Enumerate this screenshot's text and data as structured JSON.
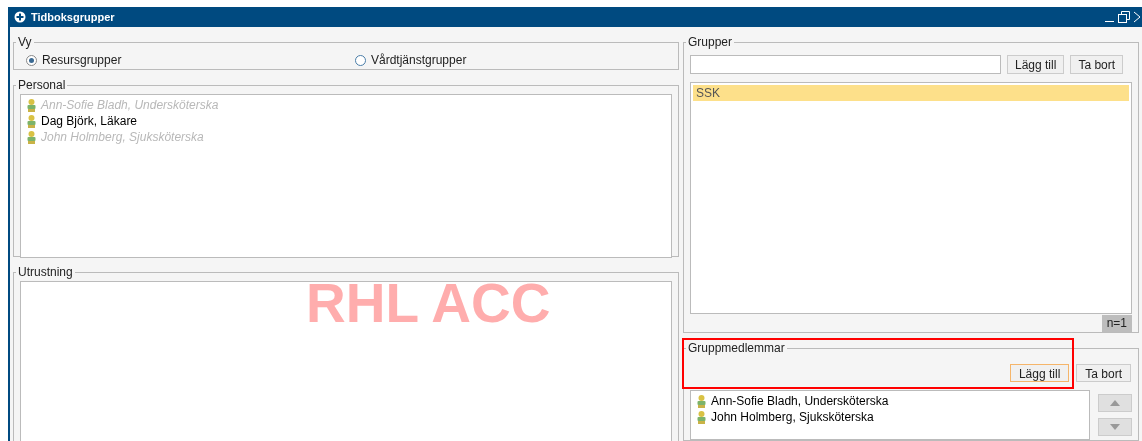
{
  "window": {
    "title": "Tidboksgrupper",
    "environment_label": "RHL ACC"
  },
  "vy": {
    "title": "Vy",
    "options": [
      {
        "label": "Resursgrupper",
        "selected": true
      },
      {
        "label": "Vårdtjänstgrupper",
        "selected": false
      }
    ]
  },
  "personal": {
    "title": "Personal",
    "items": [
      {
        "label": "Ann-Sofie Bladh, Undersköterska",
        "inactive": true
      },
      {
        "label": "Dag Björk, Läkare",
        "inactive": false
      },
      {
        "label": "John Holmberg, Sjuksköterska",
        "inactive": true
      }
    ]
  },
  "utrustning": {
    "title": "Utrustning"
  },
  "grupper": {
    "title": "Grupper",
    "add_button": "Lägg till",
    "remove_button": "Ta bort",
    "items": [
      {
        "label": "SSK",
        "selected": true
      }
    ],
    "count": "n=1"
  },
  "gruppmedlemmar": {
    "title": "Gruppmedlemmar",
    "highlighted": true,
    "add_button": "Lägg till",
    "remove_button": "Ta bort",
    "items": [
      {
        "label": "Ann-Sofie Bladh, Undersköterska"
      },
      {
        "label": "John Holmberg, Sjuksköterska"
      }
    ]
  }
}
